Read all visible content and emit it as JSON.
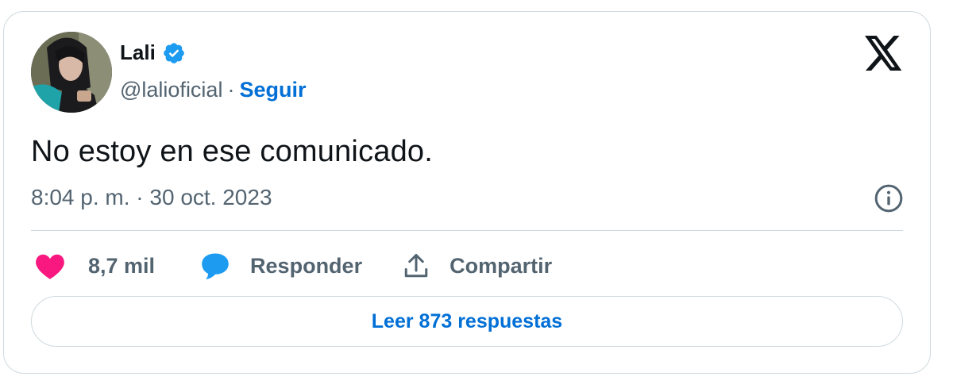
{
  "author": {
    "name": "Lali",
    "handle": "@lalioficial",
    "separator": "·",
    "follow_label": "Seguir",
    "avatar_icon": "profile-photo",
    "verified_icon": "verified-badge-icon"
  },
  "brand": {
    "logo_icon": "x-logo-icon"
  },
  "tweet": {
    "text": "No estoy en ese comunicado.",
    "timestamp": "8:04 p. m. · 30 oct. 2023"
  },
  "actions": {
    "like_count": "8,7 mil",
    "reply_label": "Responder",
    "share_label": "Compartir"
  },
  "read_replies_label": "Leer 873 respuestas",
  "colors": {
    "link_blue": "#006fd6",
    "verified_blue": "#1d9bf0",
    "heart_pink": "#f91880",
    "secondary_text": "#536471",
    "primary_text": "#0f1419",
    "border": "#cfd9de"
  }
}
